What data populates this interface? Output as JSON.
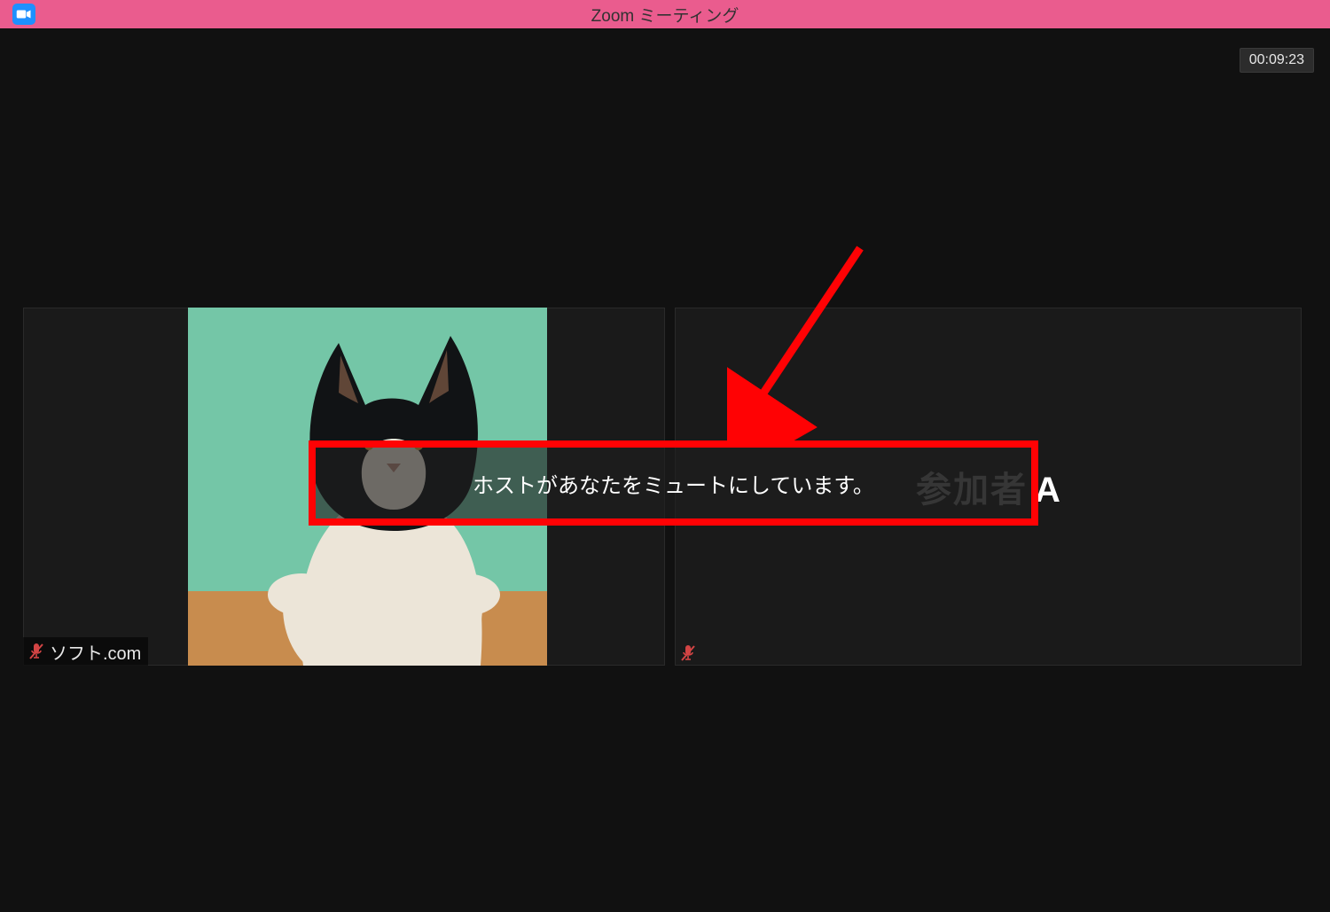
{
  "titlebar": {
    "title": "Zoom ミーティング",
    "app_icon": "zoom-camera-icon"
  },
  "timer": {
    "elapsed": "00:09:23"
  },
  "tiles": {
    "left": {
      "participant_name": "ソフト.com",
      "muted": true
    },
    "right": {
      "participant_name_prefix": "参加者",
      "participant_name_letter": "A",
      "muted": true
    }
  },
  "notification": {
    "message": "ホストがあなたをミュートにしています。"
  },
  "annotation": {
    "arrow_color": "#ff0204",
    "highlight_border_color": "#ff0204"
  }
}
